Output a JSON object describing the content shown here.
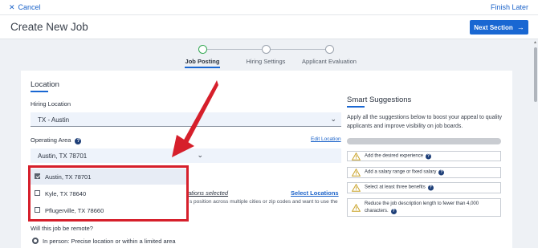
{
  "topbar": {
    "cancel_label": "Cancel",
    "finish_label": "Finish Later"
  },
  "header": {
    "title": "Create New Job",
    "next_label": "Next Section"
  },
  "steps": [
    {
      "label": "Job Posting",
      "active": true
    },
    {
      "label": "Hiring Settings",
      "active": false
    },
    {
      "label": "Applicant Evaluation",
      "active": false
    }
  ],
  "location": {
    "section_title": "Location",
    "hiring_location_label": "Hiring Location",
    "hiring_location_value": "TX - Austin",
    "operating_area_label": "Operating Area",
    "operating_area_value": "Austin, TX 78701",
    "edit_location_label": "Edit Location",
    "locations_selected_fragment": "ations selected",
    "select_locations_label": "Select Locations",
    "description_fragment": "s position across multiple cities or zip codes and want to use the",
    "remote_question": "Will this job be remote?",
    "remote_option_in_person": "In person: Precise location or within a limited area"
  },
  "dropdown": {
    "items": [
      {
        "label": "Austin, TX 78701",
        "checked": true
      },
      {
        "label": "Kyle, TX 78640",
        "checked": false
      },
      {
        "label": "Pflugerville, TX 78660",
        "checked": false
      }
    ]
  },
  "smart": {
    "title": "Smart Suggestions",
    "description": "Apply all the suggestions below to boost your appeal to quality applicants and improve visibility on job boards.",
    "progress": 0,
    "suggestions": [
      "Add the desired experience",
      "Add a salary range or fixed salary",
      "Select at least three benefits",
      "Reduce the job description length to fewer than 4,000 characters."
    ]
  },
  "colors": {
    "accent": "#1967d2",
    "annotation": "#d61f2b",
    "step_active": "#32a852"
  },
  "icons": [
    "close-icon",
    "arrow-right-icon",
    "chevron-down-icon",
    "help-icon",
    "warning-icon",
    "checkbox-icon",
    "radio-icon",
    "annotation-arrow"
  ]
}
